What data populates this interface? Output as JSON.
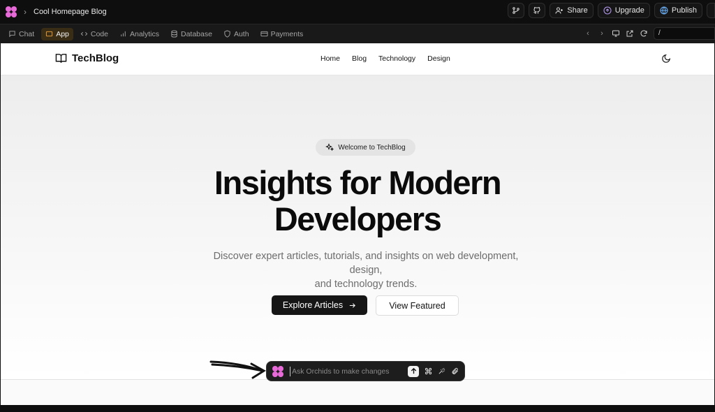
{
  "topbar": {
    "project_title": "Cool Homepage Blog",
    "buttons": {
      "share": "Share",
      "upgrade": "Upgrade",
      "publish": "Publish"
    }
  },
  "tabs": [
    {
      "label": "Chat",
      "icon": "chat-icon",
      "active": false
    },
    {
      "label": "App",
      "icon": "app-window-icon",
      "active": true
    },
    {
      "label": "Code",
      "icon": "code-icon",
      "active": false
    },
    {
      "label": "Analytics",
      "icon": "bar-chart-icon",
      "active": false
    },
    {
      "label": "Database",
      "icon": "database-icon",
      "active": false
    },
    {
      "label": "Auth",
      "icon": "shield-icon",
      "active": false
    },
    {
      "label": "Payments",
      "icon": "credit-card-icon",
      "active": false
    }
  ],
  "browser": {
    "url": "/"
  },
  "site": {
    "brand": "TechBlog",
    "nav": [
      "Home",
      "Blog",
      "Technology",
      "Design"
    ],
    "badge": "Welcome to TechBlog",
    "headline_line1": "Insights for Modern",
    "headline_line2": "Developers",
    "subtitle_line1": "Discover expert articles, tutorials, and insights on web development, design,",
    "subtitle_line2": "and technology trends.",
    "cta_primary": "Explore Articles",
    "cta_secondary": "View Featured"
  },
  "chatbar": {
    "placeholder": "Ask Orchids to make changes"
  },
  "colors": {
    "accent_flower": "#e86ad8",
    "active_tab": "#f2a33a",
    "dark_bg": "#0e0e0e"
  }
}
